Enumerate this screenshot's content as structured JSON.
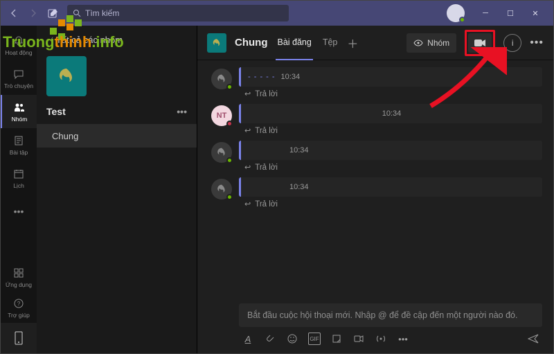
{
  "titlebar": {
    "search_placeholder": "Tìm kiếm"
  },
  "rail": {
    "items": [
      {
        "label": "Hoạt động",
        "icon": "bell"
      },
      {
        "label": "Trò chuyện",
        "icon": "chat"
      },
      {
        "label": "Nhóm",
        "icon": "teams"
      },
      {
        "label": "Bài tập",
        "icon": "assign"
      },
      {
        "label": "Lịch",
        "icon": "calendar"
      },
      {
        "label": "...",
        "icon": "dots"
      }
    ],
    "bottom": [
      {
        "label": "Ứng dụng",
        "icon": "apps"
      },
      {
        "label": "Trợ giúp",
        "icon": "help"
      },
      {
        "label": "",
        "icon": "device"
      }
    ]
  },
  "left": {
    "header": "Tất cả các nhóm",
    "team_name": "Test",
    "channel": "Chung"
  },
  "main": {
    "channel_title": "Chung",
    "tabs": [
      "Bài đăng",
      "Tệp"
    ],
    "group_btn": "Nhóm",
    "posts": [
      {
        "avatar": "wreath",
        "presence": "green",
        "time": "10:34",
        "dashed": true
      },
      {
        "avatar": "NT",
        "presence": "red",
        "time": "10:34",
        "dashed": false
      },
      {
        "avatar": "wreath",
        "presence": "green",
        "time": "10:34",
        "dashed": false
      },
      {
        "avatar": "wreath",
        "presence": "green",
        "time": "10:34",
        "dashed": false
      }
    ],
    "reply_label": "Trả lời",
    "compose_placeholder": "Bắt đầu cuộc hội thoại mới. Nhập @ để đề cập đến một người nào đó."
  },
  "watermark": "Truongthinh.info"
}
